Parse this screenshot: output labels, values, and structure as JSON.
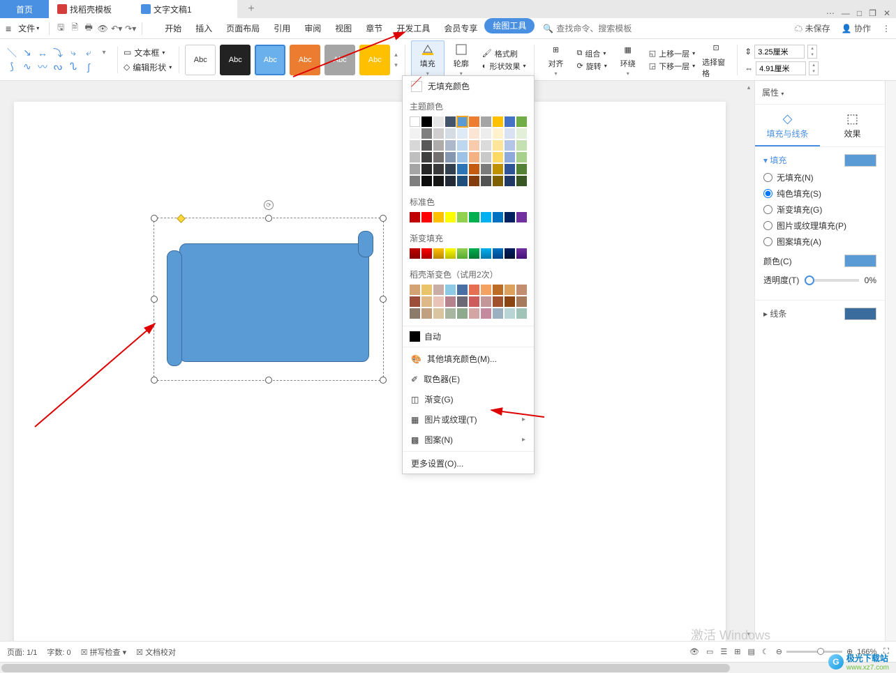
{
  "tabs": {
    "home": "首页",
    "template": "找稻壳模板",
    "doc": "文字文稿1",
    "add": "+"
  },
  "window": {
    "min": "—",
    "max": "□",
    "restore": "❐",
    "close": "✕"
  },
  "menu": {
    "file": "文件",
    "tabs": [
      "开始",
      "插入",
      "页面布局",
      "引用",
      "审阅",
      "视图",
      "章节",
      "开发工具",
      "会员专享",
      "绘图工具"
    ],
    "search_ph": "查找命令、搜索模板",
    "unsaved": "未保存",
    "collab": "协作"
  },
  "ribbon": {
    "textbox": "文本框",
    "editshape": "编辑形状",
    "style_label": "Abc",
    "fill": "填充",
    "outline": "轮廓",
    "formatpainter": "格式刷",
    "shapeeffect": "形状效果",
    "align": "对齐",
    "group": "组合",
    "rotate": "旋转",
    "wrap": "环绕",
    "selpane": "选择窗格",
    "up": "上移一层",
    "down": "下移一层",
    "width": "3.25厘米",
    "height": "4.91厘米"
  },
  "dropdown": {
    "nofill": "无填充颜色",
    "theme": "主题颜色",
    "standard": "标准色",
    "gradient_fill": "渐变填充",
    "docer": "稻壳渐变色（试用2次）",
    "auto": "自动",
    "more": "其他填充颜色(M)...",
    "picker": "取色器(E)",
    "gradient": "渐变(G)",
    "texture": "图片或纹理(T)",
    "pattern": "图案(N)",
    "moreset": "更多设置(O)..."
  },
  "panel": {
    "title": "属性",
    "tab_fill": "填充与线条",
    "tab_effect": "效果",
    "sec_fill": "填充",
    "nofill": "无填充(N)",
    "solid": "纯色填充(S)",
    "gradient": "渐变填充(G)",
    "pictex": "图片或纹理填充(P)",
    "pattern": "图案填充(A)",
    "color": "颜色(C)",
    "opacity": "透明度(T)",
    "opacity_val": "0%",
    "sec_line": "线条"
  },
  "status": {
    "page": "页面: 1/1",
    "words": "字数: 0",
    "spell": "拼写检查",
    "proof": "文档校对",
    "zoom": "166%",
    "winact": "激活 Windows"
  },
  "watermark": {
    "site": "极光下载站",
    "url": "www.xz7.com"
  }
}
